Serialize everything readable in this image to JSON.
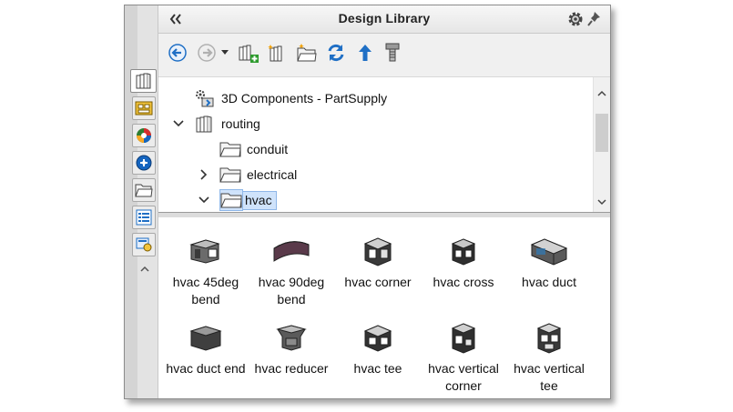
{
  "panel": {
    "title": "Design Library",
    "collapse_icon": "double-chevron-left-icon",
    "options_icon": "gear-icon",
    "pin_icon": "pushpin-icon"
  },
  "toolbar": {
    "buttons": [
      {
        "name": "back",
        "icon": "back-arrow-icon",
        "enabled": true
      },
      {
        "name": "forward",
        "icon": "forward-arrow-icon",
        "enabled": false
      },
      {
        "name": "history-dropdown",
        "icon": "dropdown-arrow-icon",
        "enabled": true
      },
      {
        "name": "add-to-library",
        "icon": "add-to-library-icon"
      },
      {
        "name": "add-file-location",
        "icon": "add-file-location-icon"
      },
      {
        "name": "create-new-folder",
        "icon": "new-folder-icon"
      },
      {
        "name": "refresh",
        "icon": "refresh-icon"
      },
      {
        "name": "up-one-level",
        "icon": "up-arrow-icon"
      },
      {
        "name": "toolbox",
        "icon": "bolt-icon"
      }
    ]
  },
  "side_tabs": [
    {
      "name": "design-library",
      "icon": "library-books-icon",
      "active": true
    },
    {
      "name": "toolbox",
      "icon": "toolbox-icon"
    },
    {
      "name": "3d-content-central",
      "icon": "globe-icon"
    },
    {
      "name": "view-palette",
      "icon": "palette-icon"
    },
    {
      "name": "file-explorer",
      "icon": "folder-icon"
    },
    {
      "name": "custom-properties",
      "icon": "properties-list-icon"
    },
    {
      "name": "appearances",
      "icon": "appearances-icon"
    }
  ],
  "tree": [
    {
      "label": "3D Components - PartSupply",
      "icon": "components-icon",
      "expander": "none",
      "level": 0
    },
    {
      "label": "routing",
      "icon": "library-books-icon",
      "expander": "expanded",
      "level": 0
    },
    {
      "label": "conduit",
      "icon": "folder-icon",
      "expander": "none",
      "level": 1
    },
    {
      "label": "electrical",
      "icon": "folder-icon",
      "expander": "collapsed",
      "level": 1
    },
    {
      "label": "hvac",
      "icon": "folder-icon",
      "expander": "expanded",
      "level": 1,
      "selected": true
    }
  ],
  "items": [
    {
      "label": "hvac 45deg bend",
      "icon": "hvac-45deg-bend-icon"
    },
    {
      "label": "hvac 90deg bend",
      "icon": "hvac-90deg-bend-icon"
    },
    {
      "label": "hvac corner",
      "icon": "hvac-corner-icon"
    },
    {
      "label": "hvac cross",
      "icon": "hvac-cross-icon"
    },
    {
      "label": "hvac duct",
      "icon": "hvac-duct-icon"
    },
    {
      "label": "hvac duct end",
      "icon": "hvac-duct-end-icon"
    },
    {
      "label": "hvac reducer",
      "icon": "hvac-reducer-icon"
    },
    {
      "label": "hvac tee",
      "icon": "hvac-tee-icon"
    },
    {
      "label": "hvac vertical corner",
      "icon": "hvac-vertical-corner-icon"
    },
    {
      "label": "hvac vertical tee",
      "icon": "hvac-vertical-tee-icon"
    }
  ],
  "colors": {
    "selection": "#cfe3fb",
    "accent_blue": "#1f6fc5",
    "folder": "#f4f4f4"
  }
}
